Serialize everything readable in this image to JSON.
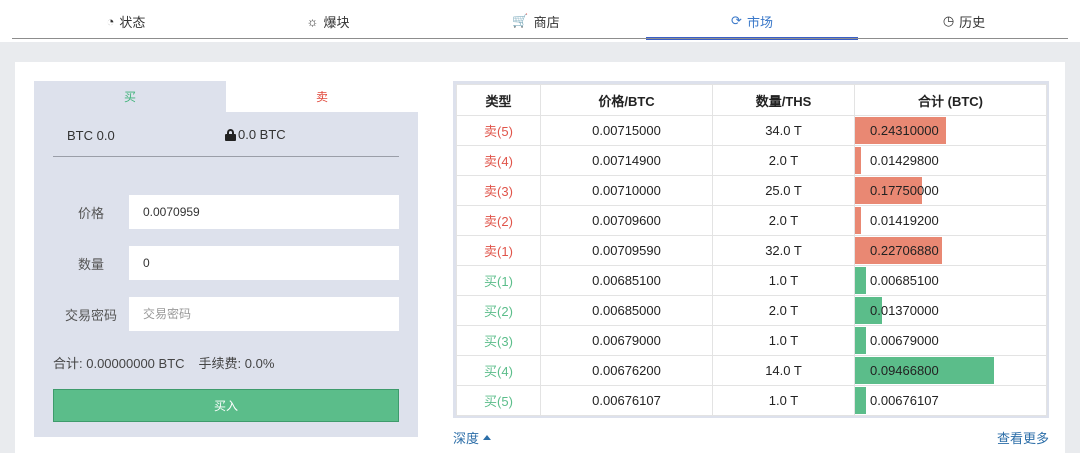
{
  "nav": {
    "tabs": [
      {
        "label": "状态",
        "icon": "dashboard-icon",
        "glyph": "◔"
      },
      {
        "label": "爆块",
        "icon": "sun-icon",
        "glyph": "☼"
      },
      {
        "label": "商店",
        "icon": "cart-icon",
        "glyph": "🛒"
      },
      {
        "label": "市场",
        "icon": "refresh-icon",
        "glyph": "⟳"
      },
      {
        "label": "历史",
        "icon": "clock-icon",
        "glyph": "◷"
      }
    ],
    "active": "市场"
  },
  "trade": {
    "buy_tab": "买",
    "sell_tab": "卖",
    "balance_btc": "BTC 0.0",
    "locked_btc": "0.0 BTC",
    "price_label": "价格",
    "price_value": "0.0070959",
    "qty_label": "数量",
    "qty_value": "0",
    "pwd_label": "交易密码",
    "pwd_placeholder": "交易密码",
    "total": "合计: 0.00000000 BTC",
    "fee": "手续费: 0.0%",
    "buy_button": "买入"
  },
  "orderbook": {
    "headers": [
      "类型",
      "价格/BTC",
      "数量/THS",
      "合计 (BTC)"
    ],
    "rows": [
      {
        "type": "卖(5)",
        "side": "sell",
        "price": "0.00715000",
        "qty": "34.0 T",
        "sum": "0.24310000",
        "fill": 0.48
      },
      {
        "type": "卖(4)",
        "side": "sell",
        "price": "0.00714900",
        "qty": "2.0 T",
        "sum": "0.01429800",
        "fill": 0.03
      },
      {
        "type": "卖(3)",
        "side": "sell",
        "price": "0.00710000",
        "qty": "25.0 T",
        "sum": "0.17750000",
        "fill": 0.35
      },
      {
        "type": "卖(2)",
        "side": "sell",
        "price": "0.00709600",
        "qty": "2.0 T",
        "sum": "0.01419200",
        "fill": 0.03
      },
      {
        "type": "卖(1)",
        "side": "sell",
        "price": "0.00709590",
        "qty": "32.0 T",
        "sum": "0.22706880",
        "fill": 0.46
      },
      {
        "type": "买(1)",
        "side": "buy",
        "price": "0.00685100",
        "qty": "1.0 T",
        "sum": "0.00685100",
        "fill": 0.06
      },
      {
        "type": "买(2)",
        "side": "buy",
        "price": "0.00685000",
        "qty": "2.0 T",
        "sum": "0.01370000",
        "fill": 0.14
      },
      {
        "type": "买(3)",
        "side": "buy",
        "price": "0.00679000",
        "qty": "1.0 T",
        "sum": "0.00679000",
        "fill": 0.06
      },
      {
        "type": "买(4)",
        "side": "buy",
        "price": "0.00676200",
        "qty": "14.0 T",
        "sum": "0.09466800",
        "fill": 0.73
      },
      {
        "type": "买(5)",
        "side": "buy",
        "price": "0.00676107",
        "qty": "1.0 T",
        "sum": "0.00676107",
        "fill": 0.06
      }
    ]
  },
  "footer": {
    "depth": "深度",
    "more": "查看更多"
  },
  "colors": {
    "accent": "#3a78c9",
    "sell": "#e0544a",
    "buy": "#5bbd8a"
  }
}
